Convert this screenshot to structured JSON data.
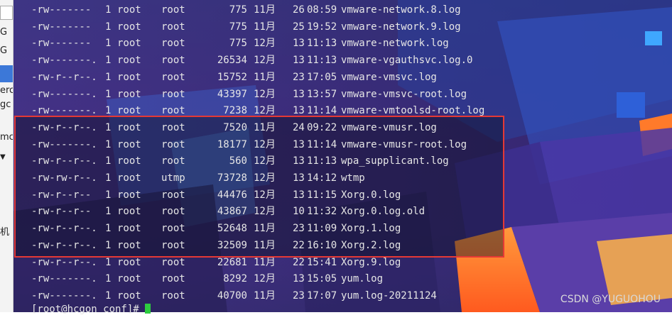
{
  "listing": [
    {
      "perm": "-rw-------",
      "links": "1",
      "owner": "root",
      "group": "root",
      "size": "775",
      "month": "11月",
      "day": "26",
      "time": "08:59",
      "name": "vmware-network.8.log"
    },
    {
      "perm": "-rw-------",
      "links": "1",
      "owner": "root",
      "group": "root",
      "size": "775",
      "month": "11月",
      "day": "25",
      "time": "19:52",
      "name": "vmware-network.9.log"
    },
    {
      "perm": "-rw-------",
      "links": "1",
      "owner": "root",
      "group": "root",
      "size": "775",
      "month": "12月",
      "day": "13",
      "time": "11:13",
      "name": "vmware-network.log"
    },
    {
      "perm": "-rw-------.",
      "links": "1",
      "owner": "root",
      "group": "root",
      "size": "26534",
      "month": "12月",
      "day": "13",
      "time": "11:13",
      "name": "vmware-vgauthsvc.log.0"
    },
    {
      "perm": "-rw-r--r--.",
      "links": "1",
      "owner": "root",
      "group": "root",
      "size": "15752",
      "month": "11月",
      "day": "23",
      "time": "17:05",
      "name": "vmware-vmsvc.log"
    },
    {
      "perm": "-rw-------.",
      "links": "1",
      "owner": "root",
      "group": "root",
      "size": "43397",
      "month": "12月",
      "day": "13",
      "time": "13:57",
      "name": "vmware-vmsvc-root.log"
    },
    {
      "perm": "-rw-------.",
      "links": "1",
      "owner": "root",
      "group": "root",
      "size": "7238",
      "month": "12月",
      "day": "13",
      "time": "11:14",
      "name": "vmware-vmtoolsd-root.log"
    },
    {
      "perm": "-rw-r--r--.",
      "links": "1",
      "owner": "root",
      "group": "root",
      "size": "7520",
      "month": "11月",
      "day": "24",
      "time": "09:22",
      "name": "vmware-vmusr.log"
    },
    {
      "perm": "-rw-------.",
      "links": "1",
      "owner": "root",
      "group": "root",
      "size": "18177",
      "month": "12月",
      "day": "13",
      "time": "11:14",
      "name": "vmware-vmusr-root.log"
    },
    {
      "perm": "-rw-r--r--.",
      "links": "1",
      "owner": "root",
      "group": "root",
      "size": "560",
      "month": "12月",
      "day": "13",
      "time": "11:13",
      "name": "wpa_supplicant.log"
    },
    {
      "perm": "-rw-rw-r--.",
      "links": "1",
      "owner": "root",
      "group": "utmp",
      "size": "73728",
      "month": "12月",
      "day": "13",
      "time": "14:12",
      "name": "wtmp"
    },
    {
      "perm": "-rw-r--r--",
      "links": "1",
      "owner": "root",
      "group": "root",
      "size": "44476",
      "month": "12月",
      "day": "13",
      "time": "11:15",
      "name": "Xorg.0.log"
    },
    {
      "perm": "-rw-r--r--",
      "links": "1",
      "owner": "root",
      "group": "root",
      "size": "43867",
      "month": "12月",
      "day": "10",
      "time": "11:32",
      "name": "Xorg.0.log.old"
    },
    {
      "perm": "-rw-r--r--.",
      "links": "1",
      "owner": "root",
      "group": "root",
      "size": "52648",
      "month": "11月",
      "day": "23",
      "time": "11:09",
      "name": "Xorg.1.log"
    },
    {
      "perm": "-rw-r--r--.",
      "links": "1",
      "owner": "root",
      "group": "root",
      "size": "32509",
      "month": "11月",
      "day": "22",
      "time": "16:10",
      "name": "Xorg.2.log"
    },
    {
      "perm": "-rw-r--r--.",
      "links": "1",
      "owner": "root",
      "group": "root",
      "size": "22681",
      "month": "11月",
      "day": "22",
      "time": "15:41",
      "name": "Xorg.9.log"
    },
    {
      "perm": "-rw-------.",
      "links": "1",
      "owner": "root",
      "group": "root",
      "size": "8292",
      "month": "12月",
      "day": "13",
      "time": "15:05",
      "name": "yum.log"
    },
    {
      "perm": "-rw-------.",
      "links": "1",
      "owner": "root",
      "group": "root",
      "size": "40700",
      "month": "11月",
      "day": "23",
      "time": "17:07",
      "name": "yum.log-20211124"
    }
  ],
  "prompt": "[root@hcgon conf]# ",
  "watermark": "CSDN @YUGUOHOU",
  "left_strip": {
    "items": [
      "G",
      "G",
      "erc",
      "gc",
      "mc",
      "机"
    ]
  },
  "colors": {
    "highlight_border": "#e53935",
    "text": "#e6e6e6",
    "cursor": "#2ecc40"
  }
}
